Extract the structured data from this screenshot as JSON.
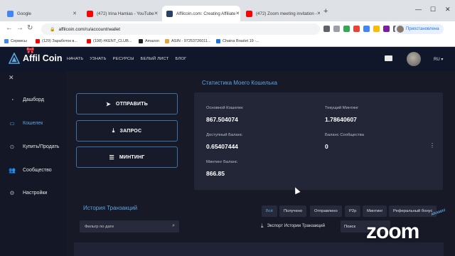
{
  "browser": {
    "tabs": [
      {
        "label": "Google",
        "color": "#4285f4"
      },
      {
        "label": "(472) Irina Hamias - YouTube",
        "color": "#ff0000"
      },
      {
        "label": "Affilcoin.com: Creating Affiliate",
        "color": "#2a3f66"
      },
      {
        "label": "(472) Zoom meeting invitation -",
        "color": "#ff0000"
      }
    ],
    "url": "affilcoin.com/ru/account/wallet",
    "profile_status": "Приостановлена",
    "bookmarks": [
      "Сервисы",
      "(129) Заработок в...",
      "(198) #KENT_CLUB...",
      "Amazon",
      "ASIN - 97253726011...",
      "Chaina Braslet 19 -..."
    ]
  },
  "site": {
    "logo": "Affil Coin",
    "menu": [
      "НАЧАТЬ",
      "УЗНАТЬ",
      "РЕСУРСЫ",
      "БЕЛЫЙ ЛИСТ",
      "БЛОГ"
    ],
    "lang": "RU",
    "accent": "#5ea6e0"
  },
  "sidebar": {
    "items": [
      {
        "label": "Дашборд",
        "icon": "dashboard-icon"
      },
      {
        "label": "Кошелек",
        "icon": "wallet-icon"
      },
      {
        "label": "Купить/Продать",
        "icon": "exchange-icon"
      },
      {
        "label": "Сообщество",
        "icon": "users-icon"
      },
      {
        "label": "Настройки",
        "icon": "gear-icon"
      }
    ]
  },
  "actions": {
    "send": "ОТПРАВИТЬ",
    "withdraw": "ЗАПРОС",
    "minting": "МИНТИНГ"
  },
  "wallet": {
    "title": "Статистика Моего Кошелька",
    "main_balance_label": "Основной Кошелек",
    "main_balance_value": "867.504074",
    "current_minting_label": "Текущий Минтинг",
    "current_minting_value": "1.78640607",
    "available_label": "Доступный Баланс",
    "available_value": "0.65407444",
    "community_label": "Баланс Сообщества",
    "community_value": "0",
    "minting_balance_label": "Минтинг Баланс",
    "minting_balance_value": "866.85"
  },
  "transactions": {
    "title": "История Транзакций",
    "filters": [
      "Всё",
      "Получено",
      "Отправлено",
      "P2p",
      "Минтинг",
      "Реферальный бонус"
    ],
    "date_filter_placeholder": "Фильтр по дате",
    "export_label": "Экспорт Истории Транзакций",
    "search_label": "Поиск"
  },
  "overlay": {
    "zoom_logo": "zoom",
    "zoom_sign": "ARAMAY"
  }
}
